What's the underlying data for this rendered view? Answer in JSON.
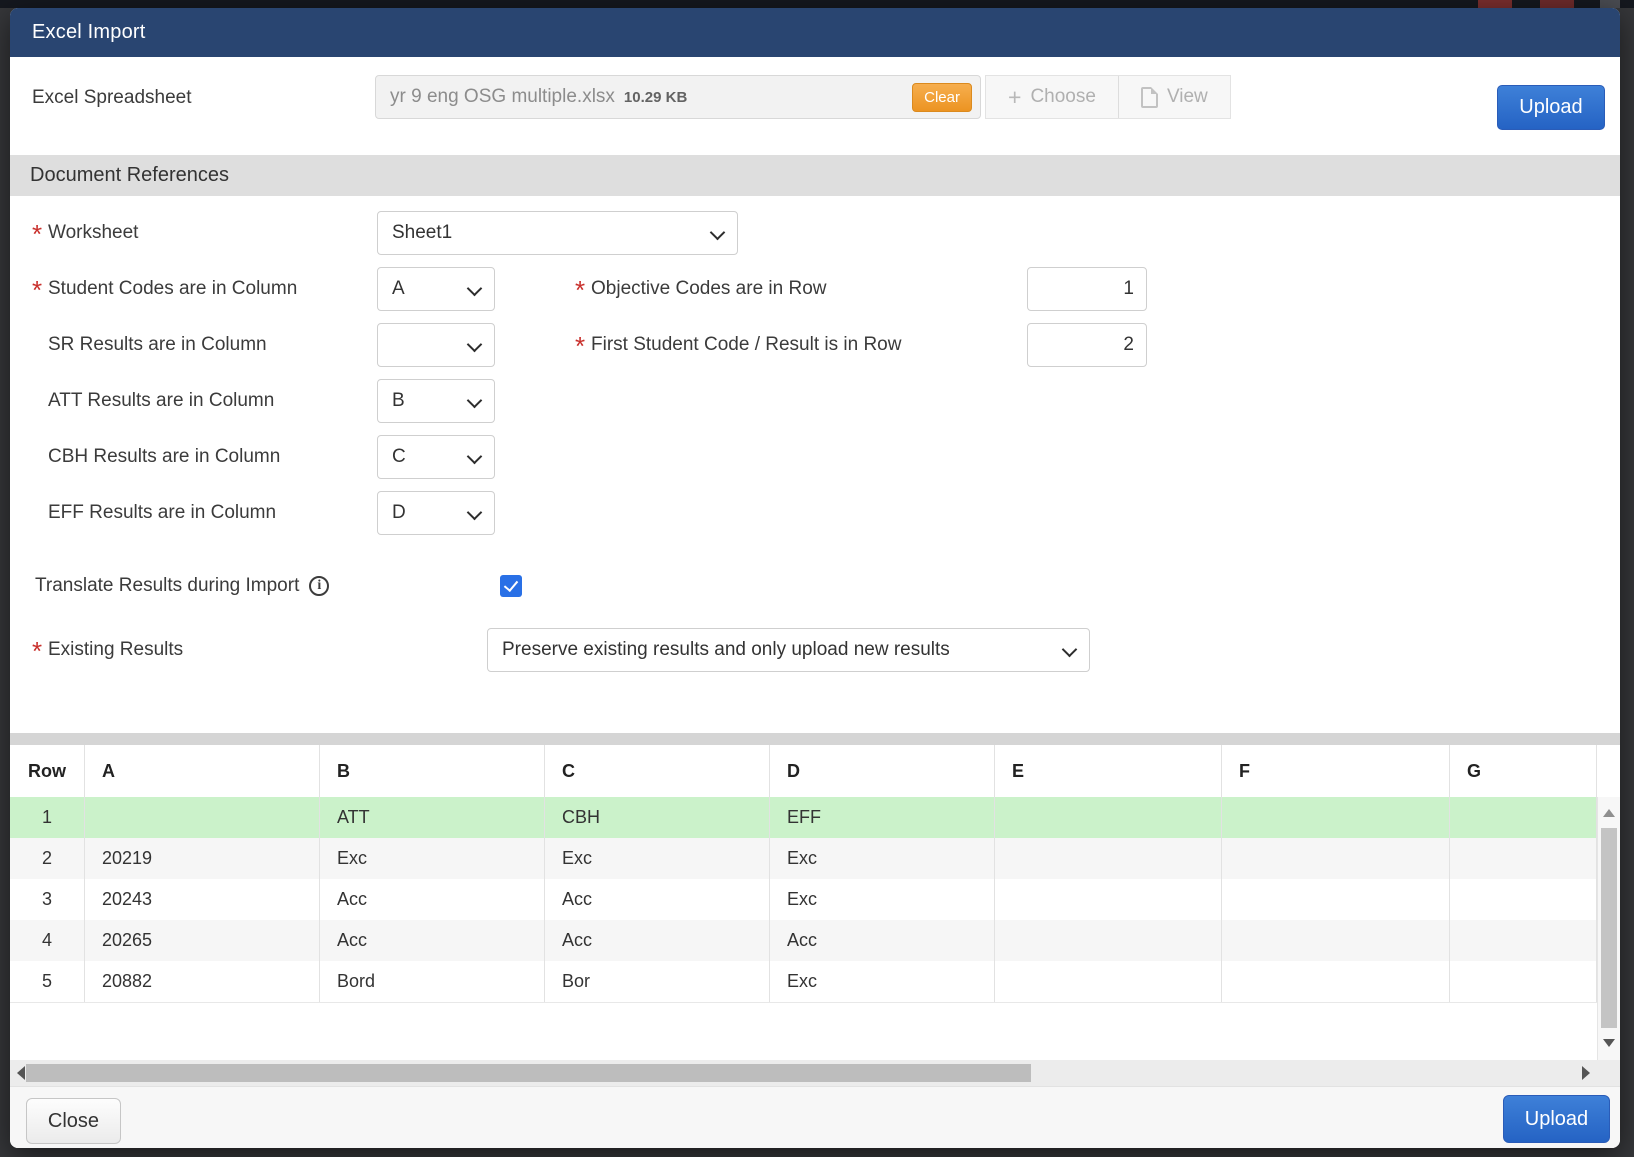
{
  "ui": {
    "required_marker": "*",
    "plus_glyph": "+",
    "info_glyph": "i"
  },
  "modal": {
    "title": "Excel Import"
  },
  "file_row": {
    "label": "Excel Spreadsheet",
    "filename": "yr 9 eng OSG multiple.xlsx",
    "filesize": "10.29 KB",
    "clear": "Clear",
    "choose": "Choose",
    "view": "View",
    "upload": "Upload"
  },
  "sections": {
    "document_references": "Document References"
  },
  "fields": {
    "worksheet": {
      "label": "Worksheet",
      "value": "Sheet1",
      "required": true
    },
    "student_codes": {
      "label": "Student Codes are in Column",
      "value": "A",
      "required": true
    },
    "objective_row": {
      "label": "Objective Codes are in Row",
      "value": "1",
      "required": true
    },
    "sr": {
      "label": "SR Results are in Column",
      "value": "",
      "required": false
    },
    "first_student_row": {
      "label": "First Student Code / Result is in Row",
      "value": "2",
      "required": true
    },
    "att": {
      "label": "ATT Results are in Column",
      "value": "B",
      "required": false
    },
    "cbh": {
      "label": "CBH Results are in Column",
      "value": "C",
      "required": false
    },
    "eff": {
      "label": "EFF Results are in Column",
      "value": "D",
      "required": false
    },
    "translate": {
      "label": "Translate Results during Import",
      "checked": true
    },
    "existing": {
      "label": "Existing Results",
      "value": "Preserve existing results and only upload new results",
      "required": true
    }
  },
  "preview_table": {
    "headers": [
      "Row",
      "A",
      "B",
      "C",
      "D",
      "E",
      "F",
      "G"
    ],
    "rows": [
      {
        "cells": [
          "1",
          "",
          "ATT",
          "CBH",
          "EFF",
          "",
          "",
          ""
        ],
        "highlight": true
      },
      {
        "cells": [
          "2",
          "20219",
          "Exc",
          "Exc",
          "Exc",
          "",
          "",
          ""
        ],
        "highlight": false
      },
      {
        "cells": [
          "3",
          "20243",
          "Acc",
          "Acc",
          "Exc",
          "",
          "",
          ""
        ],
        "highlight": false
      },
      {
        "cells": [
          "4",
          "20265",
          "Acc",
          "Acc",
          "Acc",
          "",
          "",
          ""
        ],
        "highlight": false
      },
      {
        "cells": [
          "5",
          "20882",
          "Bord",
          "Bor",
          "Exc",
          "",
          "",
          ""
        ],
        "highlight": false
      }
    ],
    "highlight_color": "#cbf2ca",
    "stripe_color": "#f6f6f6"
  },
  "footer": {
    "close": "Close",
    "upload": "Upload"
  },
  "colors": {
    "header_blue": "#294571",
    "primary_button_blue": "#2e6fce",
    "clear_orange": "#f0a63e",
    "highlight_green": "#cbf2ca"
  }
}
